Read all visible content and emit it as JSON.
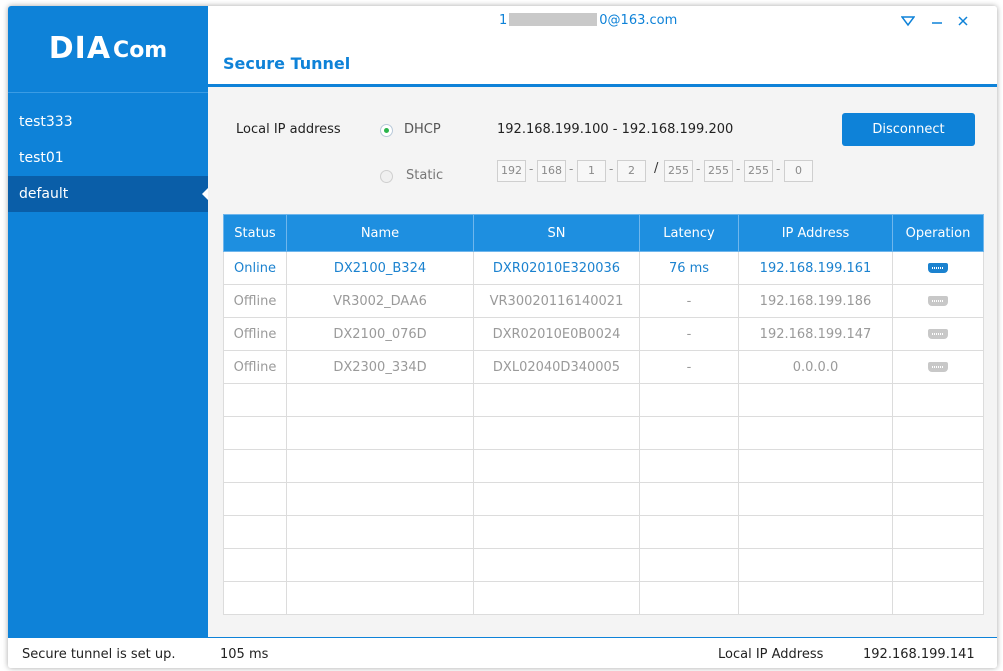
{
  "brand": {
    "logo_main": "DIA",
    "logo_sub": "Com"
  },
  "sidebar": {
    "items": [
      {
        "label": "test333"
      },
      {
        "label": "test01"
      },
      {
        "label": "default",
        "active": true
      }
    ]
  },
  "header": {
    "title": "Secure Tunnel",
    "user_prefix": "1",
    "user_suffix": "0@163.com",
    "menu_icon": "triangle-down-icon",
    "minimize_icon": "minimize-icon",
    "close_icon": "close-icon"
  },
  "settings": {
    "local_ip_label": "Local IP address",
    "dhcp_label": "DHCP",
    "dhcp_range": "192.168.199.100 - 192.168.199.200",
    "static_label": "Static",
    "ip_octets": [
      "192",
      "168",
      "1",
      "2"
    ],
    "mask_octets": [
      "255",
      "255",
      "255",
      "0"
    ],
    "disconnect_label": "Disconnect"
  },
  "table": {
    "headers": [
      "Status",
      "Name",
      "SN",
      "Latency",
      "IP Address",
      "Operation"
    ],
    "rows": [
      {
        "status": "Online",
        "name": "DX2100_B324",
        "sn": "DXR02010E320036",
        "latency": "76 ms",
        "ip": "192.168.199.161"
      },
      {
        "status": "Offline",
        "name": "VR3002_DAA6",
        "sn": "VR30020116140021",
        "latency": "-",
        "ip": "192.168.199.186"
      },
      {
        "status": "Offline",
        "name": "DX2100_076D",
        "sn": "DXR02010E0B0024",
        "latency": "-",
        "ip": "192.168.199.147"
      },
      {
        "status": "Offline",
        "name": "DX2300_334D",
        "sn": "DXL02040D340005",
        "latency": "-",
        "ip": "0.0.0.0"
      }
    ]
  },
  "statusbar": {
    "message": "Secure tunnel is set up.",
    "latency": "105 ms",
    "local_ip_label": "Local IP Address",
    "local_ip": "192.168.199.141"
  },
  "colors": {
    "accent": "#0e82d8",
    "online": "#1b82cf",
    "dhcp_dot": "#2bb54b"
  }
}
